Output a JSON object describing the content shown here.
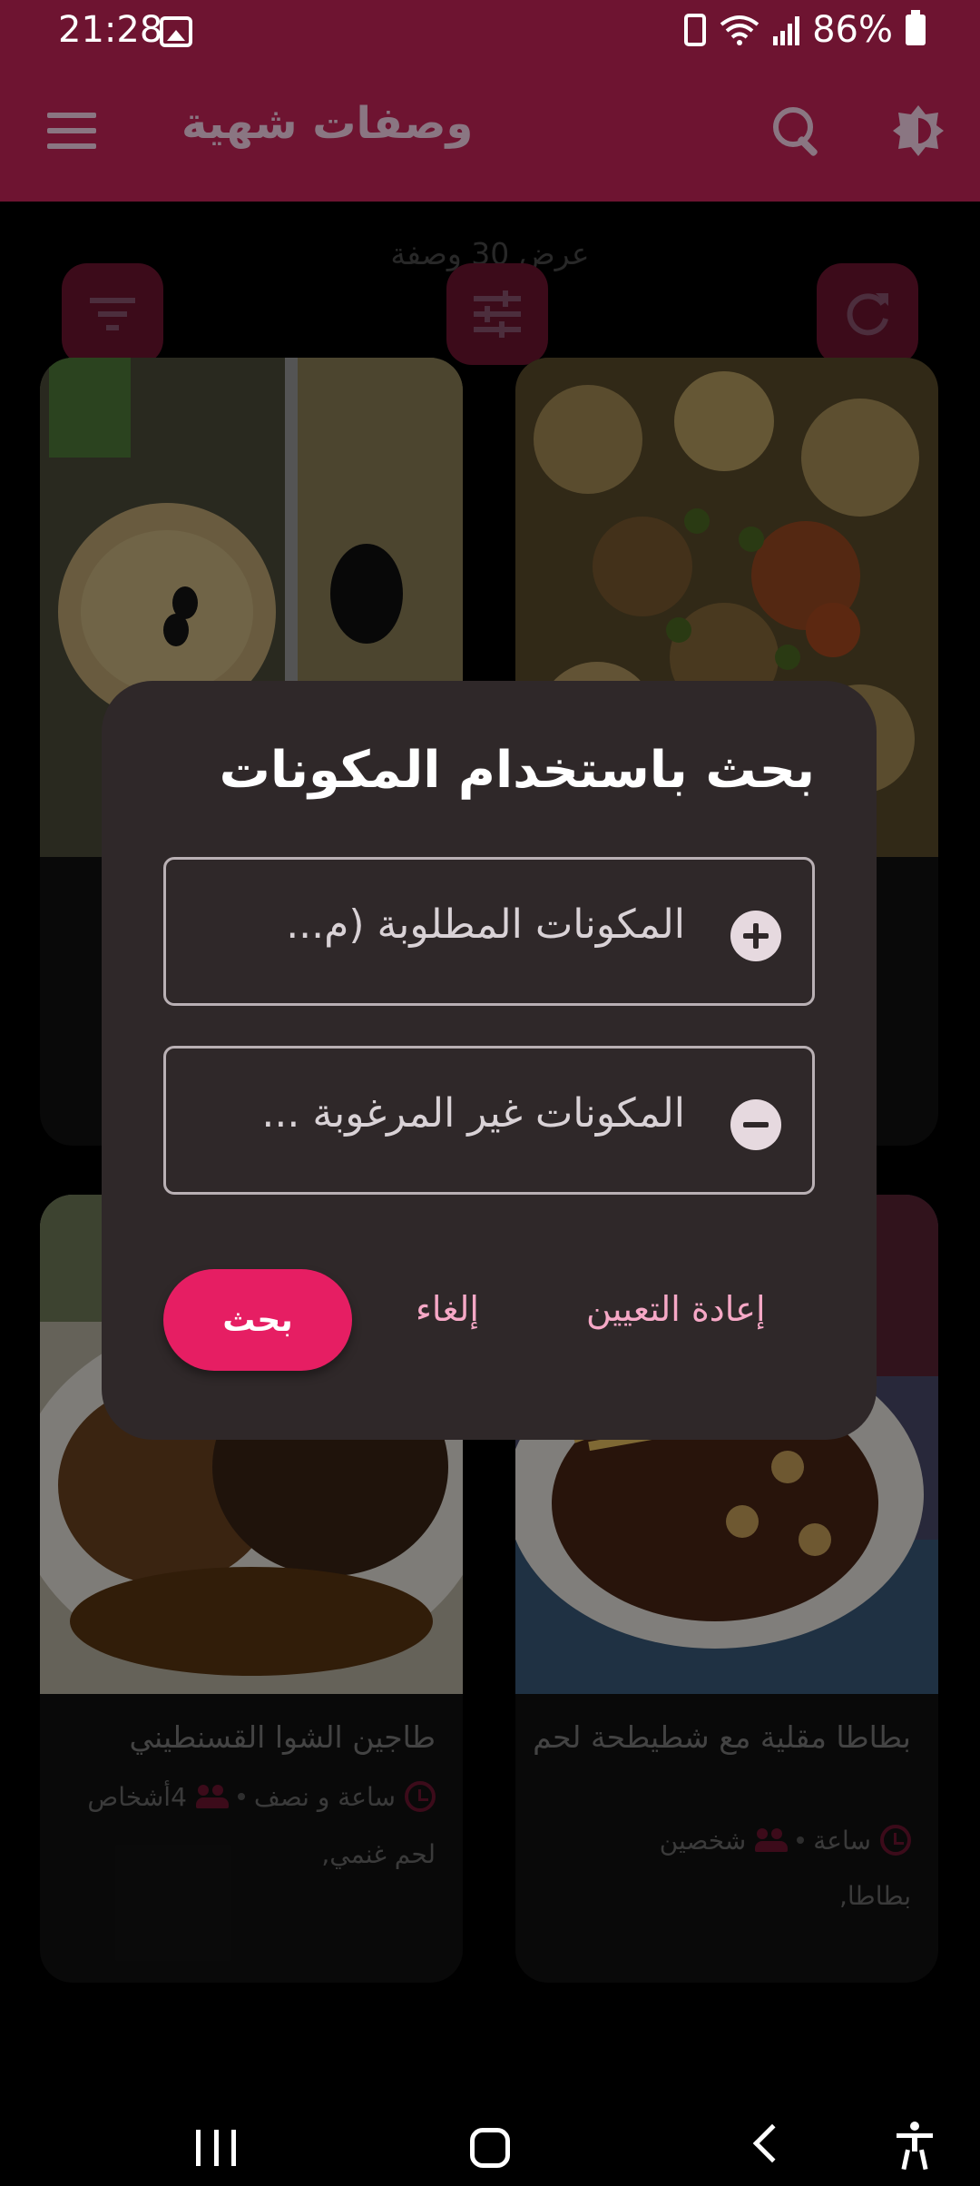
{
  "status": {
    "time": "21:28",
    "battery": "86%"
  },
  "appbar": {
    "title": "وصفات شهية"
  },
  "list": {
    "count_text": "عرض 30 وصفة"
  },
  "cards": [
    {
      "title": "",
      "time": "",
      "servings": "",
      "ingredients": ""
    },
    {
      "title": "",
      "time": "",
      "servings": "",
      "ingredients": ""
    },
    {
      "title": "طاجين الشوا القسنطيني",
      "time": "ساعة و نصف",
      "servings": "4أشخاص",
      "ingredients": "لحم غنمي,"
    },
    {
      "title": "بطاطا مقلية مع شطيطحة لحم",
      "time": "ساعة",
      "servings": "شخصين",
      "ingredients": "بطاطا,"
    }
  ],
  "dialog": {
    "title": "بحث باستخدام المكونات",
    "included_placeholder": "المكونات المطلوبة (م...",
    "excluded_placeholder": "المكونات غير المرغوبة ...",
    "search_label": "بحث",
    "cancel_label": "إلغاء",
    "reset_label": "إعادة التعيين"
  },
  "colors": {
    "primary": "#6e1431",
    "accent": "#e61e63",
    "dialog_bg": "#2f2829",
    "text_button": "#f6a8c6"
  }
}
